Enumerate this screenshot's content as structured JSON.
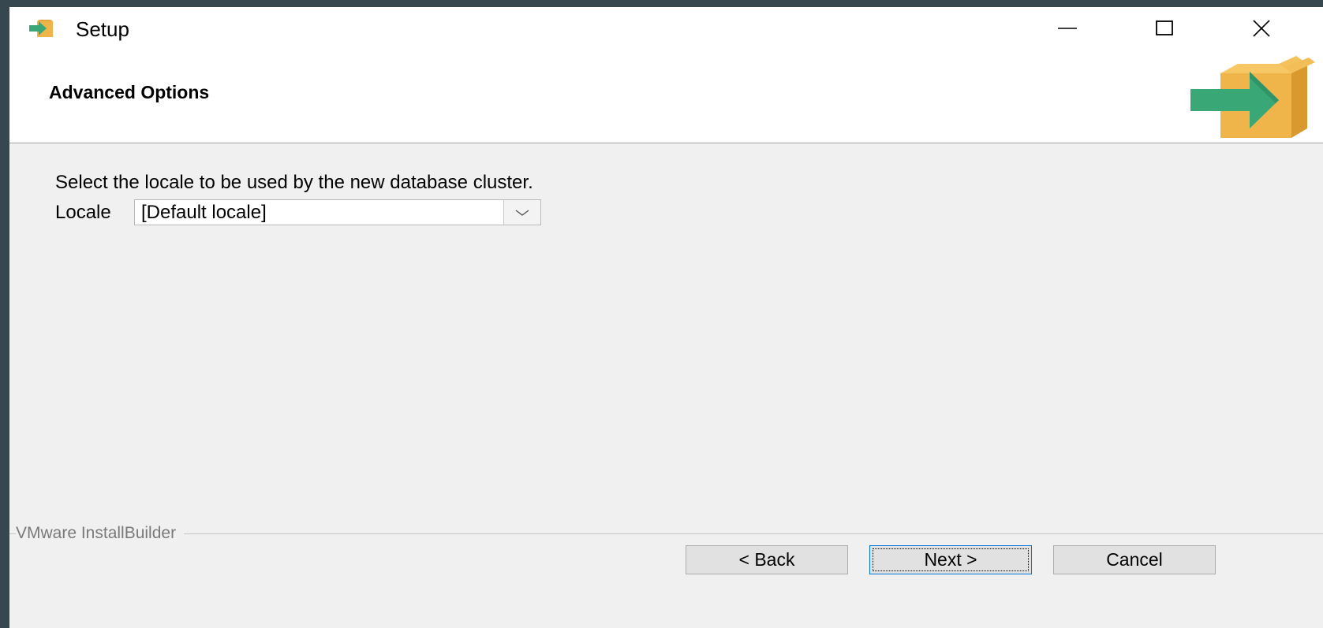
{
  "window": {
    "title": "Setup",
    "icon": "installer-box-icon",
    "controls": {
      "minimize_icon": "minimize-icon",
      "maximize_icon": "maximize-icon",
      "close_icon": "close-icon"
    }
  },
  "header": {
    "title": "Advanced Options",
    "logo": "installer-box-arrow-icon"
  },
  "content": {
    "instruction": "Select the locale to be used by the new database cluster.",
    "locale": {
      "label": "Locale",
      "value": "[Default locale]"
    }
  },
  "footer": {
    "brand": "VMware InstallBuilder",
    "back_label": "< Back",
    "next_label": "Next >",
    "cancel_label": "Cancel"
  },
  "colors": {
    "background": "#37474f",
    "window": "#f0f0f0",
    "header": "#ffffff",
    "box": "#f0b54a",
    "arrow": "#3aa876"
  }
}
